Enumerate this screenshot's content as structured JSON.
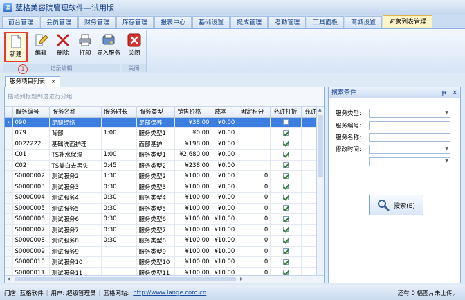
{
  "app": {
    "title": "蓝格美容院管理软件—试用版"
  },
  "tabs": [
    "前台管理",
    "会员管理",
    "财务管理",
    "库存管理",
    "报表中心",
    "基础设置",
    "提成管理",
    "考勤管理",
    "工具面板",
    "商城设置",
    "对象列表管理"
  ],
  "ribbon": {
    "group1_label": "记录编辑",
    "group2_label": "关闭",
    "new_label": "新建",
    "edit_label": "编辑",
    "delete_label": "删除",
    "print_label": "打印",
    "import_label": "导入服务",
    "close_label": "关闭",
    "marker": "1"
  },
  "doc_tab": {
    "label": "服务项目列表",
    "close": "×"
  },
  "grid": {
    "group_hint": "拖动列标题到这进行分组",
    "columns": [
      "服务编号",
      "服务名称",
      "服务时长",
      "服务类型",
      "销售价格",
      "成本",
      "固定积分",
      "允许打折",
      "允许"
    ],
    "rows": [
      {
        "code": "090",
        "name": "足腿经络",
        "duration": "",
        "type": "足部保养",
        "price": "¥38.00",
        "cost": "¥0.00",
        "points": "",
        "discount": false
      },
      {
        "code": "079",
        "name": "背部",
        "duration": "1:00",
        "type": "服务类型1",
        "price": "¥0.00",
        "cost": "¥0.00",
        "points": "",
        "discount": true
      },
      {
        "code": "0022222",
        "name": "基础洗面护理",
        "duration": "",
        "type": "面部基护",
        "price": "¥198.00",
        "cost": "¥0.00",
        "points": "",
        "discount": true
      },
      {
        "code": "C01",
        "name": "TS补水保湿",
        "duration": "1:00",
        "type": "服务类型1",
        "price": "¥2,680.00",
        "cost": "¥0.00",
        "points": "",
        "discount": true
      },
      {
        "code": "C02",
        "name": "TS美白去黑头",
        "duration": "0:45",
        "type": "服务类型2",
        "price": "¥238.00",
        "cost": "¥0.00",
        "points": "",
        "discount": true
      },
      {
        "code": "S0000002",
        "name": "测试服务2",
        "duration": "1:30",
        "type": "服务类型2",
        "price": "¥100.00",
        "cost": "¥0.00",
        "points": "0",
        "discount": true
      },
      {
        "code": "S0000003",
        "name": "测试服务3",
        "duration": "0:30",
        "type": "服务类型3",
        "price": "¥100.00",
        "cost": "¥0.00",
        "points": "0",
        "discount": true
      },
      {
        "code": "S0000004",
        "name": "测试服务4",
        "duration": "0:30",
        "type": "服务类型4",
        "price": "¥100.00",
        "cost": "¥0.00",
        "points": "0",
        "discount": true
      },
      {
        "code": "S0000005",
        "name": "测试服务5",
        "duration": "0:30",
        "type": "服务类型5",
        "price": "¥100.00",
        "cost": "¥0.00",
        "points": "0",
        "discount": true
      },
      {
        "code": "S0000006",
        "name": "测试服务6",
        "duration": "0:30",
        "type": "服务类型6",
        "price": "¥100.00",
        "cost": "¥10.00",
        "points": "0",
        "discount": true
      },
      {
        "code": "S0000007",
        "name": "测试服务7",
        "duration": "0:30",
        "type": "服务类型7",
        "price": "¥100.00",
        "cost": "¥10.00",
        "points": "0",
        "discount": true
      },
      {
        "code": "S0000008",
        "name": "测试服务8",
        "duration": "0:30",
        "type": "服务类型8",
        "price": "¥100.00",
        "cost": "¥10.00",
        "points": "0",
        "discount": true
      },
      {
        "code": "S0000009",
        "name": "测试服务9",
        "duration": "",
        "type": "服务类型9",
        "price": "¥100.00",
        "cost": "¥10.00",
        "points": "0",
        "discount": true
      },
      {
        "code": "S0000010",
        "name": "测试服务10",
        "duration": "",
        "type": "服务类型10",
        "price": "¥100.00",
        "cost": "¥10.00",
        "points": "0",
        "discount": true
      },
      {
        "code": "S0000011",
        "name": "测试服务11",
        "duration": "",
        "type": "服务类型11",
        "price": "¥100.00",
        "cost": "¥10.00",
        "points": "0",
        "discount": true
      }
    ]
  },
  "search": {
    "title": "搜索条件",
    "pin": "ᵽ",
    "close": "×",
    "type_label": "服务类型:",
    "code_label": "服务编号:",
    "name_label": "服务名称:",
    "modified_label": "修改时间:",
    "button_label": "搜索(E)"
  },
  "status": {
    "store_label": "门店: 蓝格软件",
    "user_label": "用户: 超级管理员",
    "site_label": "蓝格网站:",
    "site_url": "http://www.lange.com.cn",
    "upload_text": "还有 0 幅图片未上传。"
  },
  "colors": {
    "selected_row": "#3b7ee0",
    "active_tab": "#fff4c8",
    "highlight_border": "#e23d2d"
  }
}
